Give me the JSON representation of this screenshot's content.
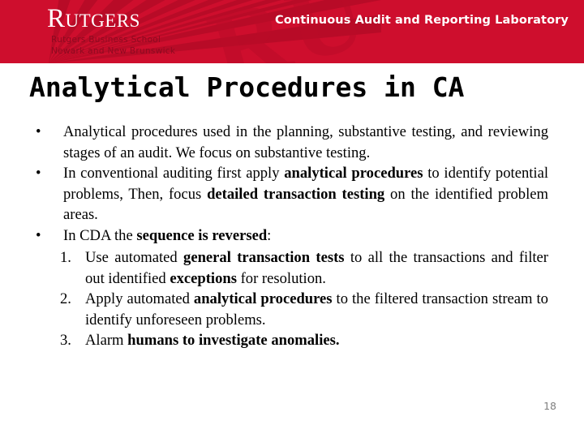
{
  "banner": {
    "logo_wordmark": "Rutgers",
    "logo_sub_line1": "Rutgers Business School",
    "logo_sub_line2": "Newark and New Brunswick",
    "lab_title": "Continuous Audit and Reporting Laboratory",
    "bg_color": "#ce0e2d",
    "sub_color": "#8d0a20"
  },
  "slide": {
    "title": "Analytical Procedures in CA",
    "page_number": "18",
    "bullet_glyph": "•"
  },
  "bullets": [
    {
      "marker": "•",
      "text": "Analytical procedures used in the planning, substantive testing, and reviewing stages of an audit. We focus on substantive testing."
    },
    {
      "marker": "•",
      "text": "In conventional auditing first apply analytical procedures to identify potential problems, Then, focus detailed transaction testing on the identified problem areas.",
      "bold_runs": [
        "analytical procedures",
        "detailed transaction testing"
      ]
    },
    {
      "marker": "•",
      "text": "In CDA the sequence is reversed:",
      "bold_runs": [
        "sequence is reversed"
      ]
    }
  ],
  "steps": [
    {
      "marker": "1.",
      "text": "Use automated general transaction tests to all the transactions and filter out identified exceptions for resolution.",
      "bold_runs": [
        "general transaction tests",
        "exceptions"
      ]
    },
    {
      "marker": "2.",
      "text": "Apply automated analytical procedures to the filtered transaction stream to identify unforeseen problems.",
      "bold_runs": [
        "analytical procedures"
      ]
    },
    {
      "marker": "3.",
      "text": "Alarm humans to investigate anomalies.",
      "bold_runs": [
        "humans to investigate anomalies."
      ]
    }
  ]
}
